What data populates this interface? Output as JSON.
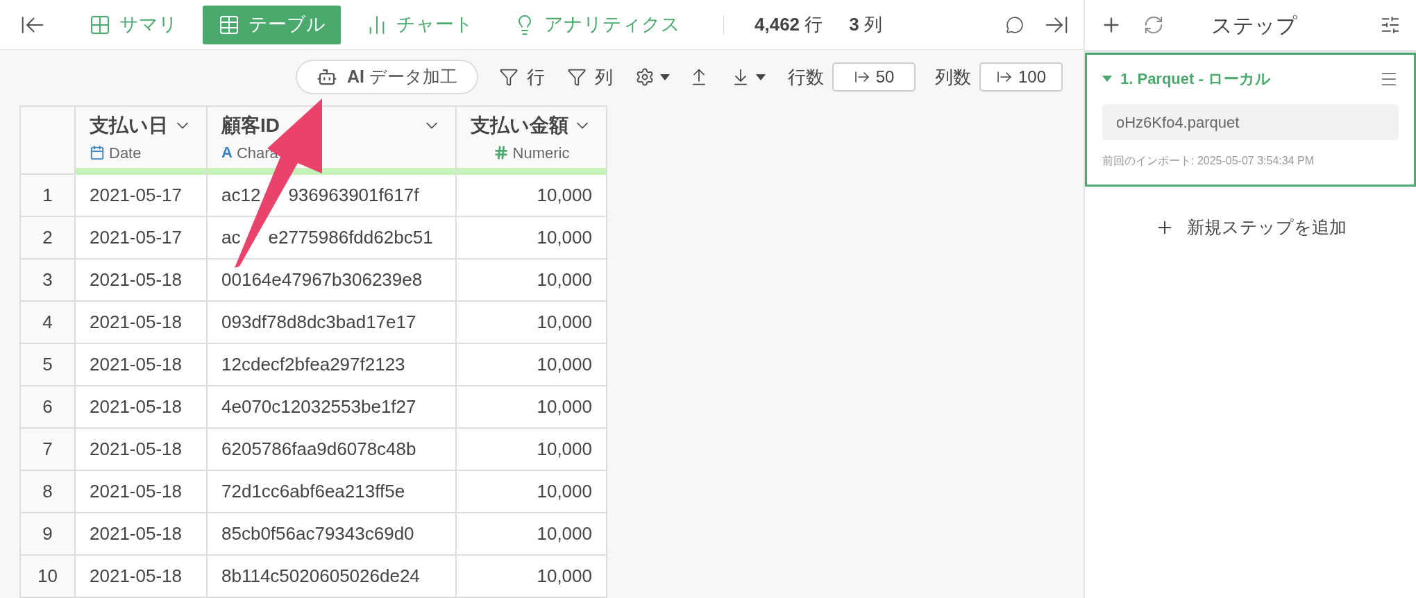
{
  "topbar": {
    "tabs": [
      {
        "label": "サマリ",
        "selected": false
      },
      {
        "label": "テーブル",
        "selected": true
      },
      {
        "label": "チャート",
        "selected": false
      },
      {
        "label": "アナリティクス",
        "selected": false
      }
    ],
    "row_count": "4,462",
    "row_unit": "行",
    "col_count": "3",
    "col_unit": "列"
  },
  "toolbar": {
    "ai_button": "**AI** データ加工",
    "row_filter": "行",
    "col_filter": "列",
    "rows_label": "行数",
    "rows_value": "50",
    "cols_label": "列数",
    "cols_value": "100"
  },
  "table": {
    "columns": [
      {
        "name": "支払い日",
        "type": "Date",
        "kind": "date"
      },
      {
        "name": "顧客ID",
        "type": "Chara",
        "kind": "text",
        "type_mark": "A"
      },
      {
        "name": "支払い金額",
        "type": "Numeric",
        "kind": "number"
      }
    ],
    "rows": [
      {
        "index": "1",
        "date": "2021-05-17",
        "customer_id": [
          "ac12",
          "936963901f617f"
        ],
        "amount": "10,000"
      },
      {
        "index": "2",
        "date": "2021-05-17",
        "customer_id": [
          "ac",
          "e2775986fdd62bc51"
        ],
        "amount": "10,000"
      },
      {
        "index": "3",
        "date": "2021-05-18",
        "customer_id": [
          "00164e47967b306239e8"
        ],
        "amount": "10,000"
      },
      {
        "index": "4",
        "date": "2021-05-18",
        "customer_id": [
          "093df78d8dc3bad17e17"
        ],
        "amount": "10,000"
      },
      {
        "index": "5",
        "date": "2021-05-18",
        "customer_id": [
          "12cdecf2bfea297f2123"
        ],
        "amount": "10,000"
      },
      {
        "index": "6",
        "date": "2021-05-18",
        "customer_id": [
          "4e070c12032553be1f27"
        ],
        "amount": "10,000"
      },
      {
        "index": "7",
        "date": "2021-05-18",
        "customer_id": [
          "6205786faa9d6078c48b"
        ],
        "amount": "10,000"
      },
      {
        "index": "8",
        "date": "2021-05-18",
        "customer_id": [
          "72d1cc6abf6ea213ff5e"
        ],
        "amount": "10,000"
      },
      {
        "index": "9",
        "date": "2021-05-18",
        "customer_id": [
          "85cb0f56ac79343c69d0"
        ],
        "amount": "10,000"
      },
      {
        "index": "10",
        "date": "2021-05-18",
        "customer_id": [
          "8b114c5020605026de24"
        ],
        "amount": "10,000"
      }
    ]
  },
  "steps_panel": {
    "title": "ステップ",
    "steps": [
      {
        "title": "1. Parquet - ローカル",
        "expanded": true,
        "selected": true,
        "file": "oHz6Kfo4.parquet",
        "note": "前回のインポート: 2025-05-07 3:54:34 PM"
      }
    ],
    "add_step": "新規ステップを追加"
  }
}
